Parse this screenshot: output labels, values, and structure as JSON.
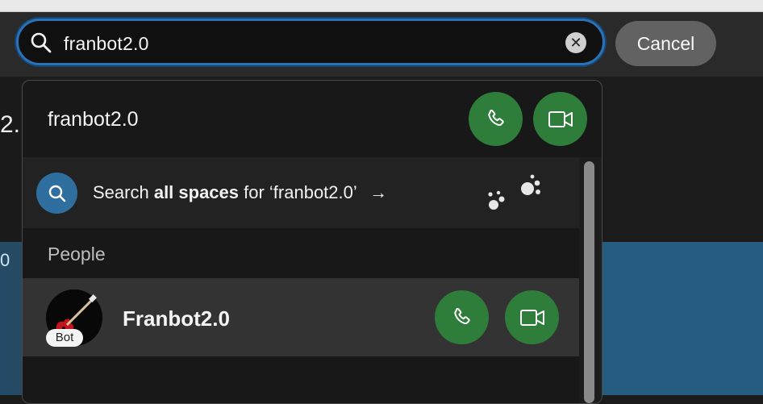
{
  "search": {
    "query": "franbot2.0",
    "cancel_label": "Cancel",
    "clear_symbol": "✕"
  },
  "background": {
    "left_fragment_top": "2.",
    "left_fragment_bottom": "0"
  },
  "dropdown": {
    "top_item": {
      "label": "franbot2.0"
    },
    "all_spaces": {
      "prefix": "Search ",
      "bold": "all spaces",
      "suffix": " for ‘franbot2.0’",
      "arrow": "→"
    },
    "people_section_label": "People",
    "people": [
      {
        "name": "Franbot2.0",
        "badge": "Bot"
      }
    ]
  },
  "icons": {
    "search": "search-icon",
    "clear": "clear-icon",
    "phone": "phone-icon",
    "video": "video-camera-icon",
    "spaces": "spaces-dots-icon",
    "avatar": "guitar-avatar"
  },
  "colors": {
    "focus_ring": "#2a72b8",
    "call_button": "#2f7d3b",
    "search_circle": "#2f6fa0",
    "cancel_button": "#626262"
  }
}
